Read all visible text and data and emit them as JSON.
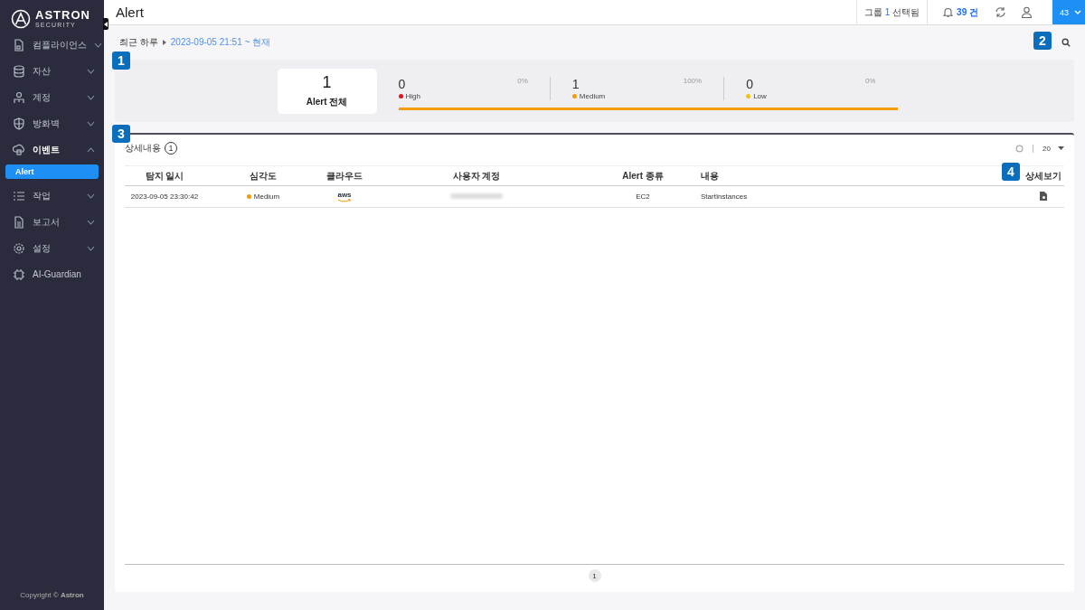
{
  "sidebar": {
    "logo": {
      "name": "ASTRON",
      "tagline": "SECURITY"
    },
    "items": [
      {
        "label": "컴플라이언스",
        "expanded": false
      },
      {
        "label": "자산",
        "expanded": false
      },
      {
        "label": "계정",
        "expanded": false
      },
      {
        "label": "방화벽",
        "expanded": false
      },
      {
        "label": "이벤트",
        "expanded": true,
        "children": [
          {
            "label": "Alert",
            "selected": true
          }
        ]
      },
      {
        "label": "작업",
        "expanded": false
      },
      {
        "label": "보고서",
        "expanded": false
      },
      {
        "label": "설정",
        "expanded": false
      },
      {
        "label": "AI-Guardian"
      }
    ],
    "copyright": "Copyright © **Astron**"
  },
  "header": {
    "title": "Alert",
    "group": {
      "prefix": "그룹",
      "count": "1",
      "suffix": "선택됨"
    },
    "notifications": "39 건",
    "user_menu": "43"
  },
  "filter": {
    "range": "최근 하루",
    "period": "2023-09-05 21:51 ~ 현재"
  },
  "summary": {
    "total": {
      "count": "1",
      "label": "Alert 전체"
    },
    "severities": [
      {
        "count": "0",
        "label": "High",
        "percent": "0%",
        "color": "#e8101a"
      },
      {
        "count": "1",
        "label": "Medium",
        "percent": "100%",
        "color": "#f59c00",
        "level": 1
      },
      {
        "count": "0",
        "label": "Low",
        "percent": "0%",
        "color": "#f5c400"
      }
    ]
  },
  "details": {
    "title": "상세내용",
    "count": "1",
    "page_size": "20",
    "columns": [
      "탐지 일시",
      "심각도",
      "클라우드",
      "사용자 계정",
      "Alert 종류",
      "내용",
      "상세보기"
    ],
    "rows": [
      {
        "time": "2023-09-05 23:30:42",
        "severity": {
          "label": "Medium",
          "color": "#f59c00"
        },
        "cloud": "aws",
        "account_hidden": true,
        "alert_type": "EC2",
        "content": "StartInstances"
      }
    ],
    "pages": [
      {
        "label": "1",
        "selected": true
      }
    ]
  },
  "annotations": [
    "1",
    "2",
    "3",
    "4"
  ]
}
